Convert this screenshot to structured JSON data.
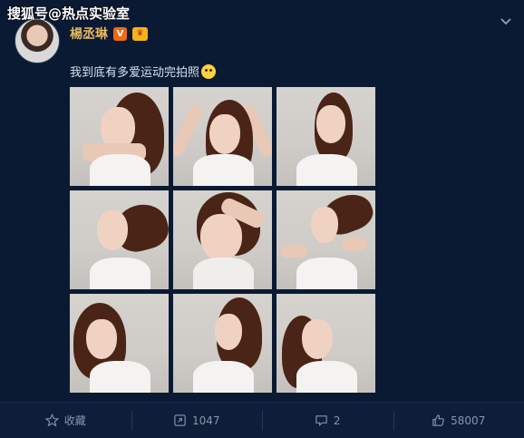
{
  "watermark": "搜狐号@热点实验室",
  "post": {
    "author": "楊丞琳",
    "vip_badge": "V",
    "crown_badge": "♛",
    "text": "我到底有多爱运动完拍照"
  },
  "icons": {
    "menu": "chevron-down-icon",
    "favorite": "star-icon",
    "repost": "repost-icon",
    "comment": "comment-icon",
    "like": "thumbs-up-icon",
    "emoji": "laugh-cry-emoji-icon"
  },
  "photos": [
    {
      "index": 1,
      "alt": "photo-1"
    },
    {
      "index": 2,
      "alt": "photo-2"
    },
    {
      "index": 3,
      "alt": "photo-3"
    },
    {
      "index": 4,
      "alt": "photo-4"
    },
    {
      "index": 5,
      "alt": "photo-5"
    },
    {
      "index": 6,
      "alt": "photo-6"
    },
    {
      "index": 7,
      "alt": "photo-7"
    },
    {
      "index": 8,
      "alt": "photo-8"
    },
    {
      "index": 9,
      "alt": "photo-9"
    }
  ],
  "actions": {
    "favorite_label": "收藏",
    "repost_count": "1047",
    "comment_count": "2",
    "like_count": "58007"
  },
  "colors": {
    "background": "#0b1a33",
    "author_name": "#e6b85c",
    "vip_badge": "#f06a0f",
    "crown_badge": "#f5b21b"
  }
}
